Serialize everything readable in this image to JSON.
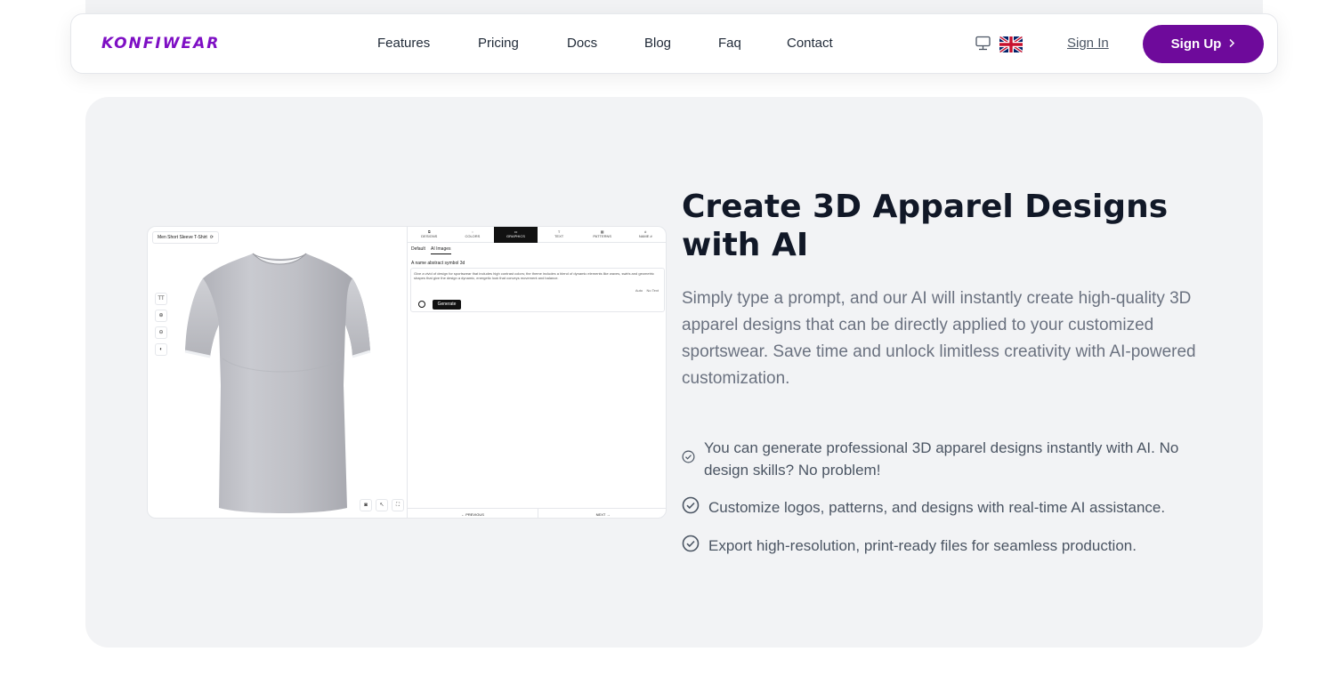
{
  "brand": {
    "logo_text": "KONFIWEAR",
    "accent_color": "#6e0a9b"
  },
  "nav": {
    "links": [
      {
        "label": "Features"
      },
      {
        "label": "Pricing"
      },
      {
        "label": "Docs"
      },
      {
        "label": "Blog"
      },
      {
        "label": "Faq"
      },
      {
        "label": "Contact"
      }
    ],
    "display_icon": "monitor-icon",
    "language_icon": "uk-flag-icon",
    "signin_label": "Sign In",
    "signup_label": "Sign Up"
  },
  "hero": {
    "title_line1": "Create 3D Apparel Designs",
    "title_line2": "with AI",
    "description": "Simply type a prompt, and our AI will instantly create high-quality 3D apparel designs that can be directly applied to your customized sportswear. Save time and unlock limitless creativity with AI-powered customization.",
    "features": [
      {
        "text": "You can generate professional 3D apparel designs instantly with AI. No design skills? No problem!",
        "icon": "check-circle-icon"
      },
      {
        "text": "Customize logos, patterns, and designs with real-time AI assistance.",
        "icon": "check-circle-icon"
      },
      {
        "text": "Export high-resolution, print-ready files for seamless production.",
        "icon": "check-circle-icon"
      }
    ]
  },
  "preview": {
    "product_name": "Men Short Sleeve T-Shirt",
    "tabs": [
      "DESIGNS",
      "COLORS",
      "GRAPHICS",
      "TEXT",
      "PATTERNS",
      "NAME #"
    ],
    "active_tab": "GRAPHICS",
    "subtabs": [
      "Default",
      "AI Images"
    ],
    "prompt_label": "A name abstract symbol 3d",
    "prompt_text": "Give a vivid of design for sportswear that includes high contrast colors; the theme includes a blend of dynamic elements like waves, swirls and geometric shapes that give the design a dynamic, energetic look that conveys movement and balance.",
    "option_auto": "Auto",
    "option_notext": "No Text",
    "generate_label": "Generate",
    "prev_label": "← PREVIOUS",
    "next_label": "NEXT →"
  }
}
